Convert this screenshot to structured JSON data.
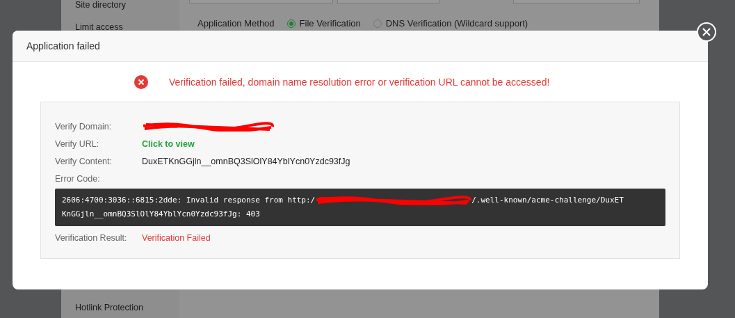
{
  "background": {
    "sidebar": {
      "items": [
        {
          "label": "Site directory"
        },
        {
          "label": "Limit access"
        },
        {
          "label": "Hotlink Protection"
        }
      ]
    },
    "application_method": {
      "label": "Application Method",
      "options": [
        {
          "label": "File Verification",
          "selected": true
        },
        {
          "label": "DNS Verification (Wildcard support)",
          "selected": false
        }
      ]
    }
  },
  "dialog": {
    "title": "Application failed",
    "message": "Verification failed, domain name resolution error or verification URL cannot be accessed!",
    "details": [
      {
        "kind": "redacted",
        "label": "Verify Domain:"
      },
      {
        "kind": "link",
        "label": "Verify URL:",
        "value": "Click to view"
      },
      {
        "kind": "text",
        "label": "Verify Content:",
        "value": "DuxETKnGGjln__omnBQ3SlOlY84YblYcn0Yzdc93fJg"
      }
    ],
    "error": {
      "label": "Error Code:",
      "before": "2606:4700:3036::6815:2dde: Invalid response from http:/",
      "after": "/.well-known/acme-challenge/DuxET",
      "line2": "KnGGjln__omnBQ3SlOlY84YblYcn0Yzdc93fJg: 403"
    },
    "result": {
      "label": "Verification Result:",
      "value": "Verification Failed"
    }
  }
}
